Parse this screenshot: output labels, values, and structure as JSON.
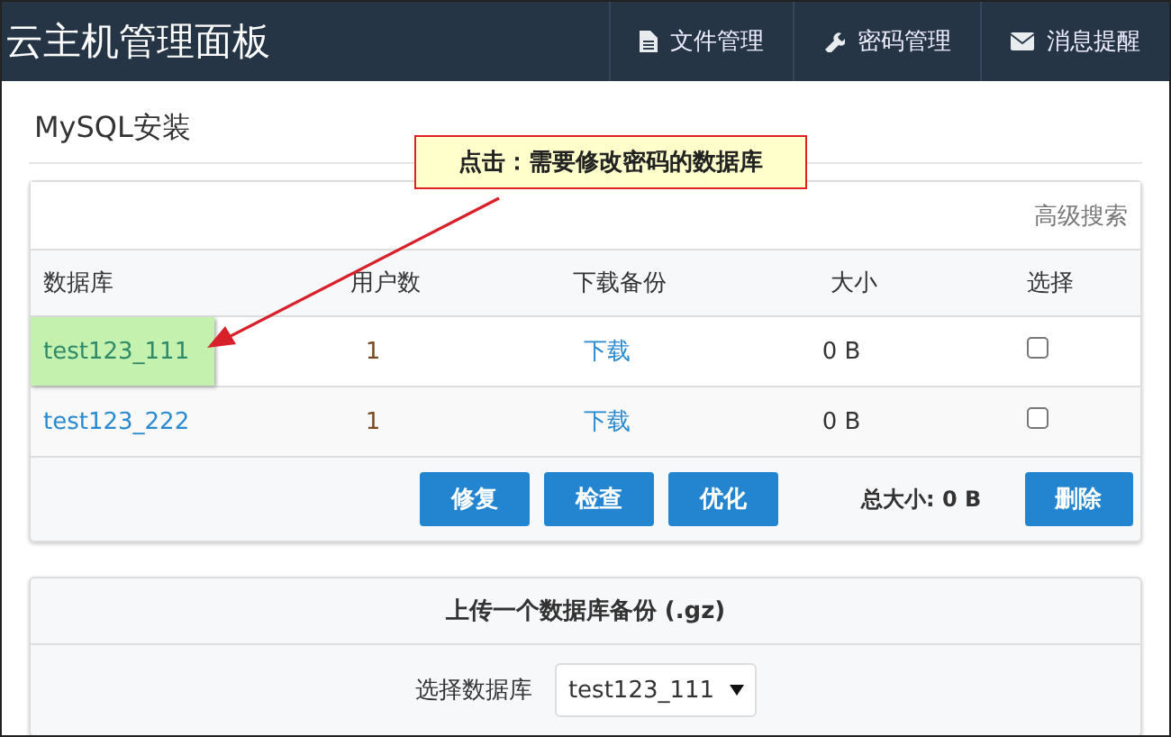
{
  "header": {
    "title": "云主机管理面板",
    "nav": [
      {
        "kind": "file",
        "label": "文件管理"
      },
      {
        "kind": "wrench",
        "label": "密码管理"
      },
      {
        "kind": "mail",
        "label": "消息提醒"
      }
    ]
  },
  "page_title": "MySQL安装",
  "callout": {
    "text": "点击：需要修改密码的数据库"
  },
  "table": {
    "advanced_search": "高级搜索",
    "columns": [
      "数据库",
      "用户数",
      "下载备份",
      "大小",
      "选择"
    ],
    "rows": [
      {
        "name": "test123_111",
        "users": "1",
        "download": "下载",
        "size": "0 B",
        "checked": false,
        "highlighted": true
      },
      {
        "name": "test123_222",
        "users": "1",
        "download": "下载",
        "size": "0 B",
        "checked": false,
        "highlighted": false
      }
    ],
    "buttons": [
      "修复",
      "检查",
      "优化"
    ],
    "total": "总大小: 0 B",
    "delete_button": "删除"
  },
  "upload": {
    "title": "上传一个数据库备份 (.gz)",
    "select_label": "选择数据库",
    "select_value": "test123_111"
  }
}
